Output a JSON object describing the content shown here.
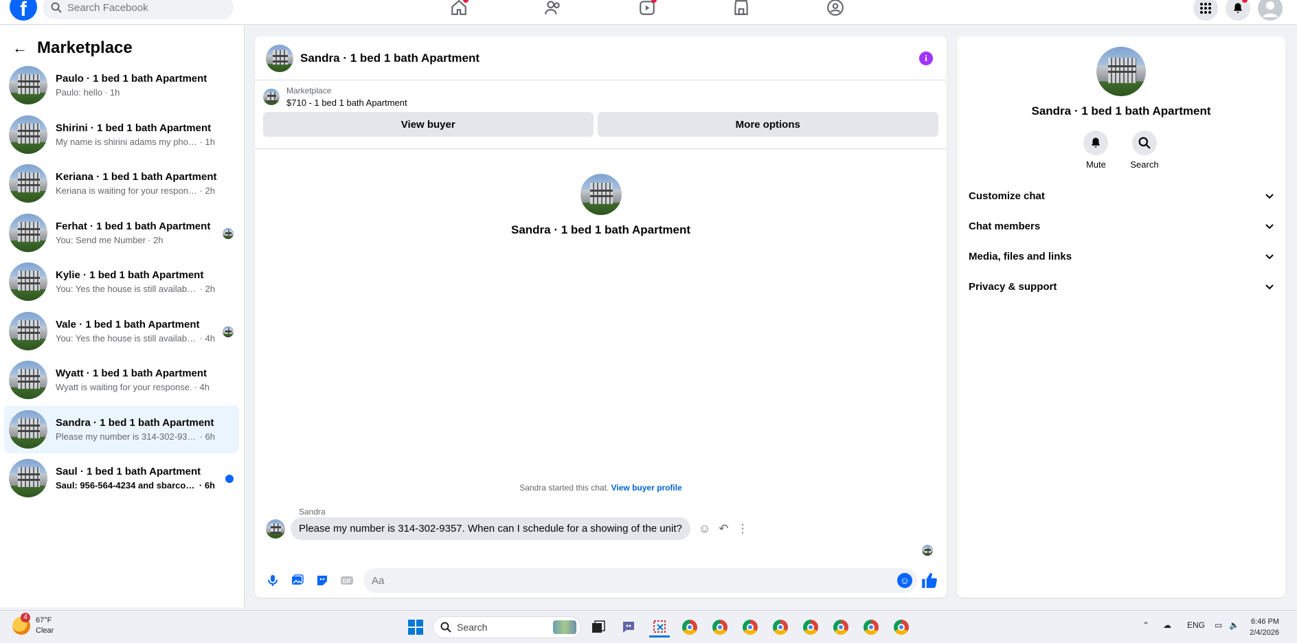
{
  "topbar": {
    "search_placeholder": "Search Facebook",
    "nav": [
      "home-icon",
      "friends-icon",
      "video-icon",
      "marketplace-icon",
      "groups-icon"
    ]
  },
  "sidebar": {
    "title": "Marketplace",
    "conversations": [
      {
        "title": "Paulo · 1 bed 1 bath Apartment",
        "preview": "Paulo: hello",
        "time": "· 1h",
        "status": "",
        "unread": false,
        "active": false
      },
      {
        "title": "Shirini · 1 bed 1 bath Apartment",
        "preview": "My name is shirini adams my phone n...",
        "time": "· 1h",
        "status": "",
        "unread": false,
        "active": false
      },
      {
        "title": "Keriana · 1 bed 1 bath Apartment",
        "preview": "Keriana is waiting for your response.",
        "time": "· 2h",
        "status": "",
        "unread": false,
        "active": false
      },
      {
        "title": "Ferhat · 1 bed 1 bath Apartment",
        "preview": "You: Send me Number",
        "time": "· 2h",
        "status": "seen",
        "unread": false,
        "active": false
      },
      {
        "title": "Kylie · 1 bed 1 bath Apartment",
        "preview": "You: Yes the house is still available Se...",
        "time": "· 2h",
        "status": "",
        "unread": false,
        "active": false
      },
      {
        "title": "Vale · 1 bed 1 bath Apartment",
        "preview": "You: Yes the house is still available ...",
        "time": "· 4h",
        "status": "seen",
        "unread": false,
        "active": false
      },
      {
        "title": "Wyatt · 1 bed 1 bath Apartment",
        "preview": "Wyatt is waiting for your response.",
        "time": "· 4h",
        "status": "",
        "unread": false,
        "active": false
      },
      {
        "title": "Sandra · 1 bed 1 bath Apartment",
        "preview": "Please my number is 314-302-9357. ...",
        "time": "· 6h",
        "status": "",
        "unread": false,
        "active": true
      },
      {
        "title": "Saul · 1 bed 1 bath Apartment",
        "preview": "Saul: 956-564-4234 and sbarco22...",
        "time": "· 6h",
        "status": "unread-dot",
        "unread": true,
        "active": false
      }
    ]
  },
  "chat": {
    "header_name": "Sandra · 1 bed 1 bath Apartment",
    "listing_source": "Marketplace",
    "listing_title": "$710 - 1 bed 1 bath Apartment",
    "view_buyer_label": "View buyer",
    "more_options_label": "More options",
    "center_name": "Sandra · 1 bed 1 bath Apartment",
    "started_text": "Sandra started this chat.",
    "view_profile_link": "View buyer profile",
    "sender": "Sandra",
    "message": "Please my number is 314-302-9357. When can I schedule for a showing of the unit?",
    "composer_placeholder": "Aa"
  },
  "details": {
    "name": "Sandra · 1 bed 1 bath Apartment",
    "actions": [
      {
        "label": "Mute",
        "icon": "bell-icon"
      },
      {
        "label": "Search",
        "icon": "search-icon"
      }
    ],
    "sections": [
      "Customize chat",
      "Chat members",
      "Media, files and links",
      "Privacy & support"
    ]
  },
  "taskbar": {
    "weather_temp": "67°F",
    "weather_desc": "Clear",
    "weather_badge": "4",
    "search_label": "Search",
    "lang": "ENG",
    "time": "6:46 PM",
    "date": "2/4/2026"
  },
  "colors": {
    "accent": "#0866ff",
    "active_row": "#ebf5ff",
    "info": "#a033ff"
  }
}
